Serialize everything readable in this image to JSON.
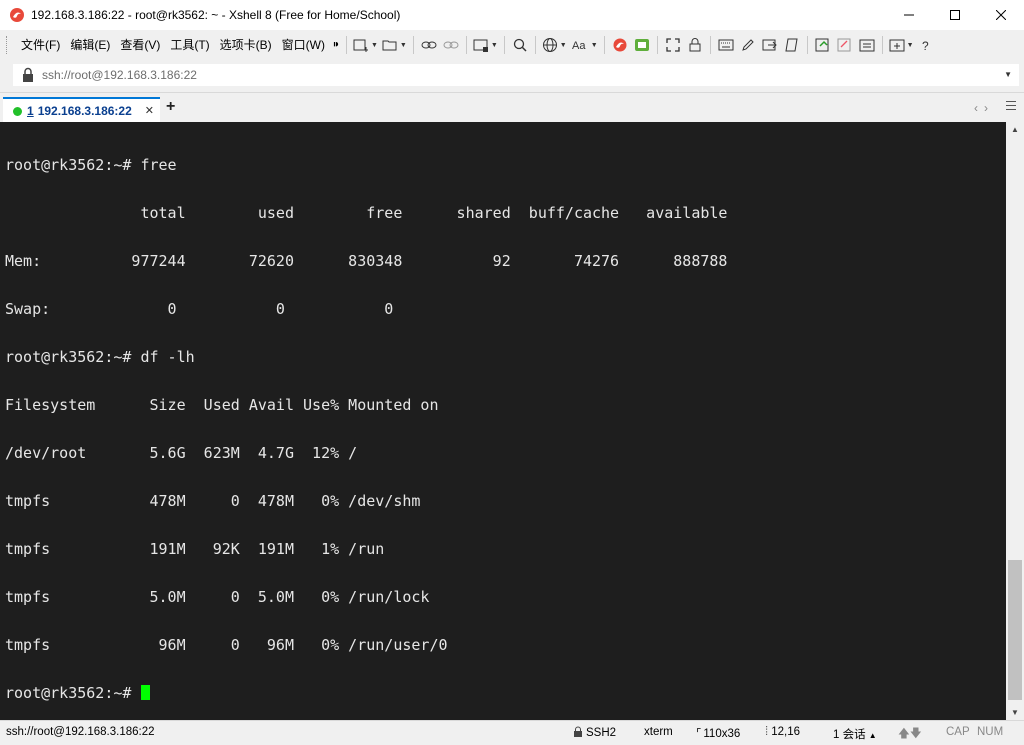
{
  "window": {
    "title": "192.168.3.186:22 - root@rk3562: ~ - Xshell 8 (Free for Home/School)"
  },
  "menu": {
    "items": [
      "文件(F)",
      "编辑(E)",
      "查看(V)",
      "工具(T)",
      "选项卡(B)",
      "窗口(W)"
    ],
    "more": "⁍"
  },
  "address": {
    "value": "ssh://root@192.168.3.186:22"
  },
  "tabs": [
    {
      "number": "1",
      "label": "192.168.3.186:22",
      "status_color": "#22c02a"
    }
  ],
  "terminal": {
    "lines": [
      "root@rk3562:~# free",
      "               total        used        free      shared  buff/cache   available",
      "Mem:          977244       72620      830348          92       74276      888788",
      "Swap:             0           0           0",
      "root@rk3562:~# df -lh",
      "Filesystem      Size  Used Avail Use% Mounted on",
      "/dev/root       5.6G  623M  4.7G  12% /",
      "tmpfs           478M     0  478M   0% /dev/shm",
      "tmpfs           191M   92K  191M   1% /run",
      "tmpfs           5.0M     0  5.0M   0% /run/lock",
      "tmpfs            96M     0   96M   0% /run/user/0"
    ],
    "prompt": "root@rk3562:~# ",
    "cursor_color": "#00ff00",
    "background": "#1e1e1e"
  },
  "status": {
    "connection": "ssh://root@192.168.3.186:22",
    "protocol": "SSH2",
    "terminal_type": "xterm",
    "size": "110x36",
    "cursor_pos": "12,16",
    "sessions": "1 会话",
    "cap": "CAP",
    "num": "NUM"
  },
  "colors": {
    "accent": "#0078d7",
    "tab_text": "#0a3f8f"
  }
}
